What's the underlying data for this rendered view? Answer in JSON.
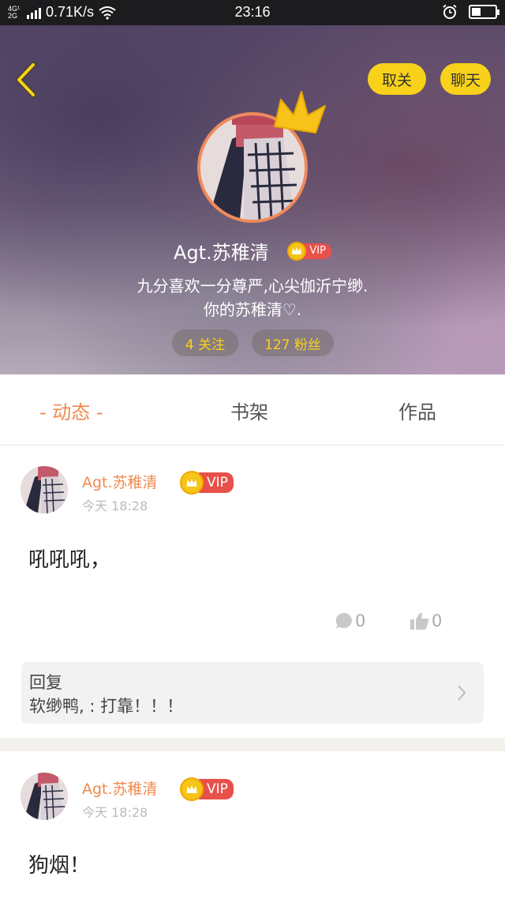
{
  "status_bar": {
    "network_type": "4G¹\n2G",
    "speed": "0.71K/s",
    "time": "23:16"
  },
  "header": {
    "unfollow_label": "取关",
    "chat_label": "聊天",
    "username": "Agt.苏稚清",
    "vip_label": "VIP",
    "bio_line1": "九分喜欢一分尊严,心尖伽沂宁缈.",
    "bio_line2": "你的苏稚清♡.",
    "following": "4 关注",
    "fans": "127 粉丝"
  },
  "tabs": {
    "dynamic": "-  动态  -",
    "shelf": "书架",
    "works": "作品"
  },
  "posts": [
    {
      "author": "Agt.苏稚清",
      "vip": "VIP",
      "time": "今天  18:28",
      "content": "吼吼吼，",
      "comments": "0",
      "likes": "0",
      "reply_title": "回复",
      "reply_content": "软缈鸭, : 打靠！！！"
    },
    {
      "author": "Agt.苏稚清",
      "vip": "VIP",
      "time": "今天  18:28",
      "content": "狗烟！"
    }
  ],
  "colors": {
    "accent_orange": "#f0894e",
    "accent_yellow": "#f8d21a",
    "vip_red": "#e8504a"
  },
  "icons": [
    "back-arrow-icon",
    "crown-icon",
    "comment-icon",
    "like-icon",
    "chevron-right-icon",
    "wifi-icon",
    "alarm-icon",
    "battery-icon"
  ]
}
